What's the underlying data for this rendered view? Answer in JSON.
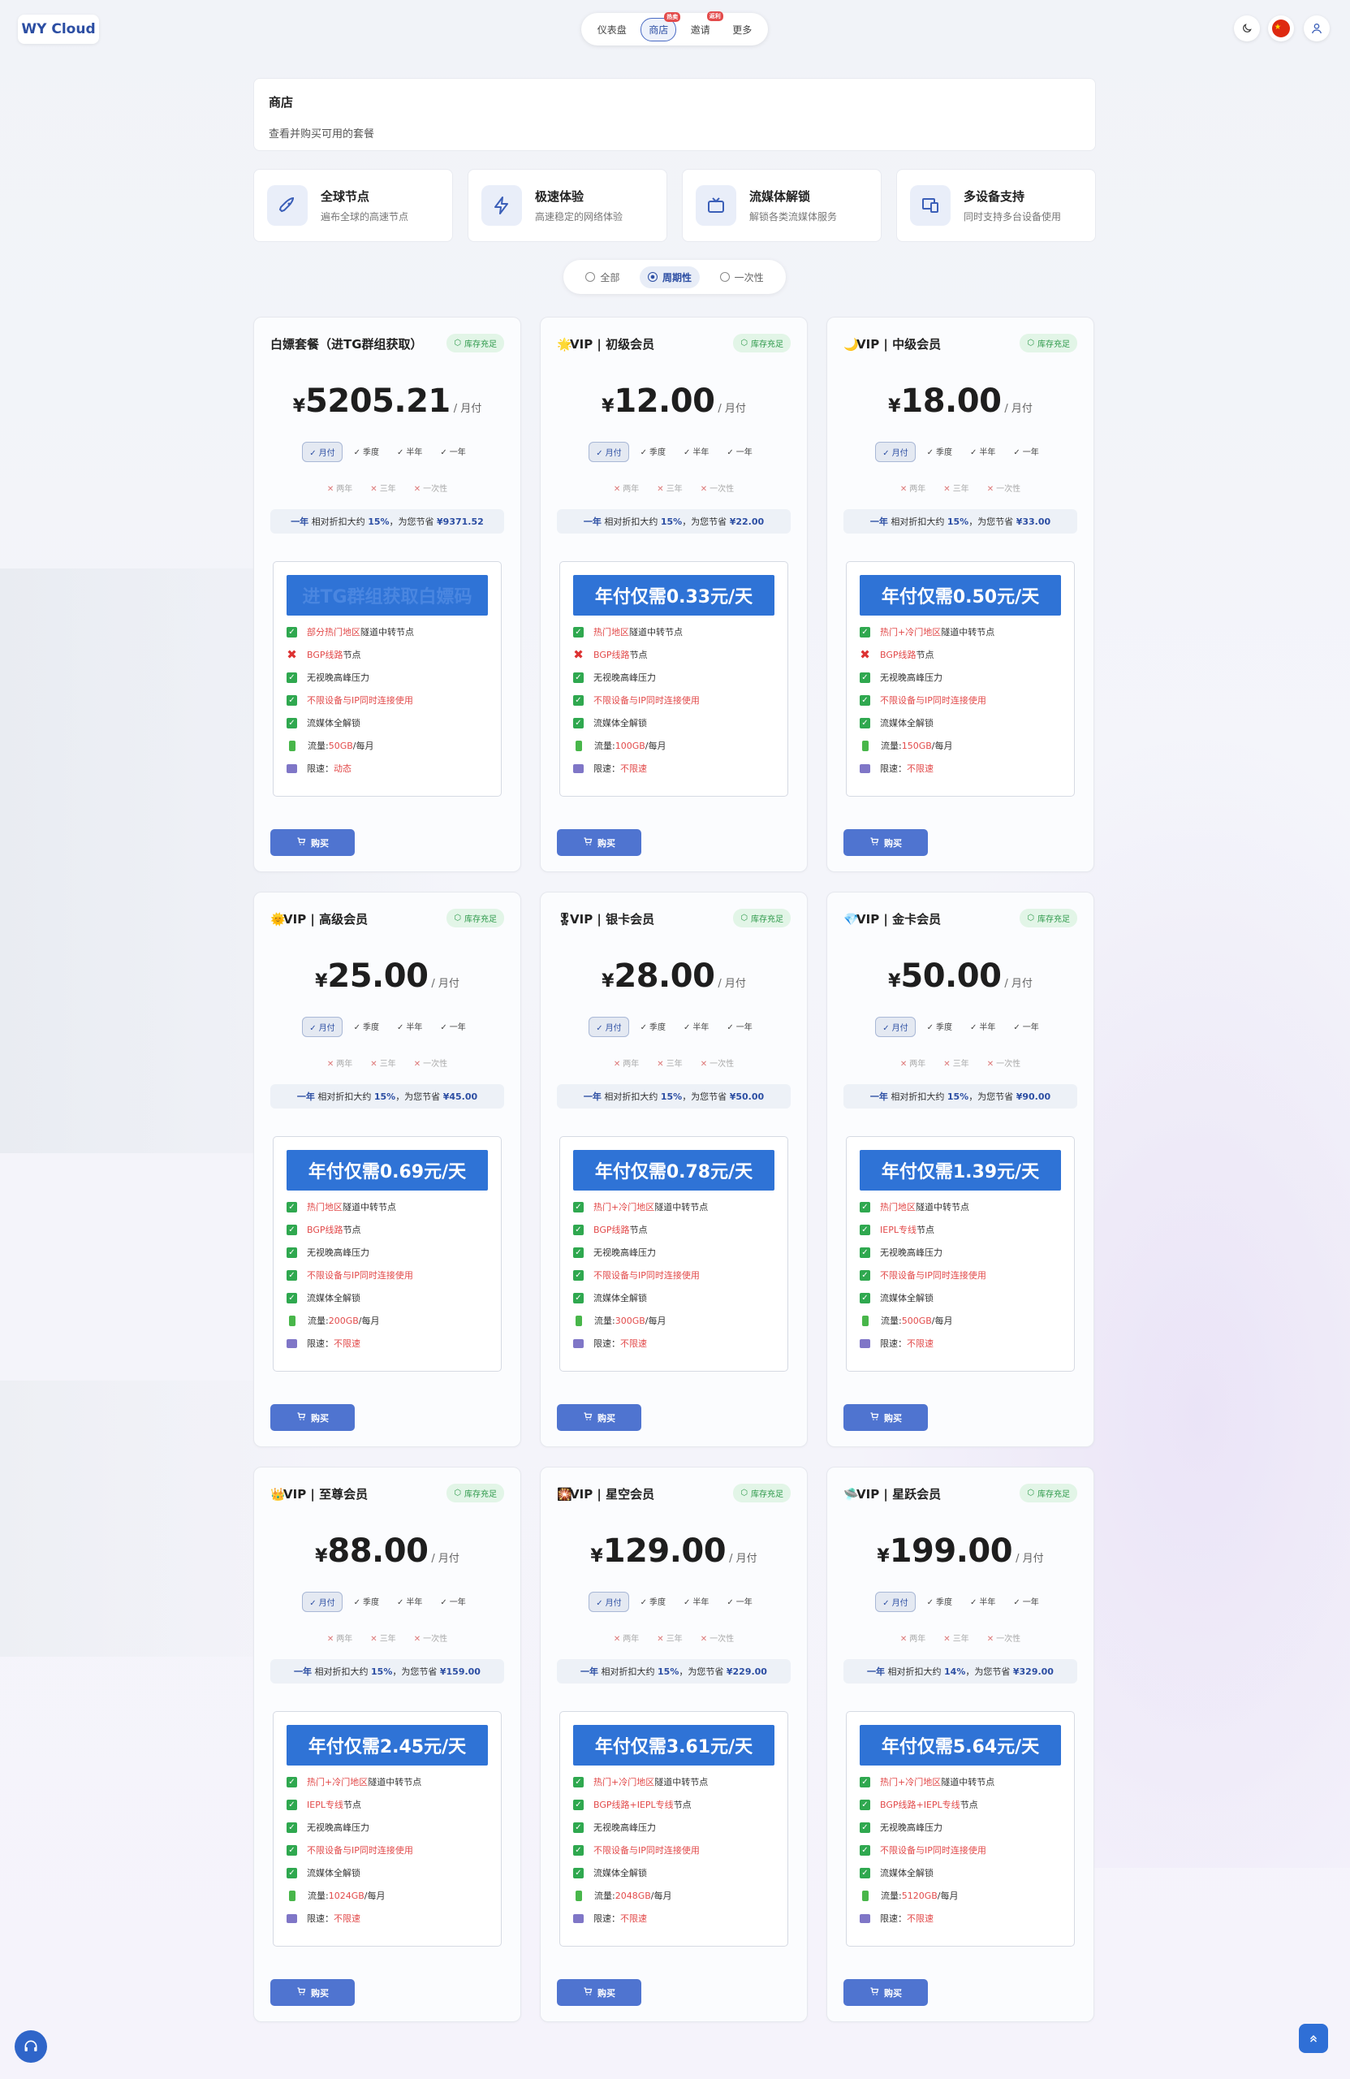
{
  "brand": "WY Cloud",
  "nav": [
    {
      "label": "仪表盘",
      "badge": ""
    },
    {
      "label": "商店",
      "badge": "热卖",
      "active": true
    },
    {
      "label": "邀请",
      "badge": "返利"
    },
    {
      "label": "更多",
      "badge": ""
    }
  ],
  "header_icons": [
    "moon-icon",
    "china-flag-icon",
    "user-icon"
  ],
  "page": {
    "title": "商店",
    "subtitle": "查看并购买可用的套餐"
  },
  "features": [
    {
      "icon": "rocket-icon",
      "title": "全球节点",
      "desc": "遍布全球的高速节点"
    },
    {
      "icon": "lightning-icon",
      "title": "极速体验",
      "desc": "高速稳定的网络体验"
    },
    {
      "icon": "tv-icon",
      "title": "流媒体解锁",
      "desc": "解锁各类流媒体服务"
    },
    {
      "icon": "devices-icon",
      "title": "多设备支持",
      "desc": "同时支持多台设备使用"
    }
  ],
  "filter": {
    "options": [
      "全部",
      "周期性",
      "一次性"
    ],
    "selected": 1
  },
  "colors": {
    "primary": "#2f73d6",
    "button": "#4f74d0",
    "stock": "#2f9a4c",
    "red": "#e24a4a"
  },
  "period_labels": {
    "month": "月付",
    "quarter": "季度",
    "half": "半年",
    "year": "一年",
    "two": "两年",
    "three": "三年",
    "once": "一次性"
  },
  "stock_label": "库存充足",
  "per_label": "/ 月付",
  "currency": "¥",
  "buy_label": "购买",
  "discount_text": {
    "prefix": "一年",
    "mid": "相对折扣大约",
    "save": "，为您节省"
  },
  "plans": [
    {
      "emoji": "",
      "name": "白嫖套餐（进TG群组获取）",
      "price": "5205.21",
      "banner": "进TG群组获取白嫖码",
      "ghost": true,
      "discount_pct": "15%",
      "discount_save": "¥9371.52",
      "features": [
        {
          "icon": "check",
          "red": "部分热门地区",
          "text": " 隧道中转节点"
        },
        {
          "icon": "cross",
          "red": "BGP线路",
          "text": "节点"
        },
        {
          "icon": "check",
          "red": "",
          "text": "无视晚高峰压力"
        },
        {
          "icon": "check",
          "red": "不限设备与IP同时连接使用",
          "text": ""
        },
        {
          "icon": "check",
          "red": "",
          "text": "流媒体全解锁"
        },
        {
          "icon": "battery",
          "pre": "流量:",
          "red": "50GB",
          "text": " /每月"
        },
        {
          "icon": "speed",
          "pre": "限速：",
          "red": "动态",
          "text": ""
        }
      ]
    },
    {
      "emoji": "🌟",
      "name": "VIP | 初级会员",
      "price": "12.00",
      "banner": "年付仅需0.33元/天",
      "discount_pct": "15%",
      "discount_save": "¥22.00",
      "features": [
        {
          "icon": "check",
          "red": "热门地区",
          "text": " 隧道中转节点"
        },
        {
          "icon": "cross",
          "red": "BGP线路",
          "text": "节点"
        },
        {
          "icon": "check",
          "red": "",
          "text": "无视晚高峰压力"
        },
        {
          "icon": "check",
          "red": "不限设备与IP同时连接使用",
          "text": ""
        },
        {
          "icon": "check",
          "red": "",
          "text": "流媒体全解锁"
        },
        {
          "icon": "battery",
          "pre": "流量:",
          "red": "100GB",
          "text": " /每月"
        },
        {
          "icon": "speed",
          "pre": "限速：",
          "red": "不限速",
          "text": ""
        }
      ]
    },
    {
      "emoji": "🌙",
      "name": "VIP | 中级会员",
      "price": "18.00",
      "banner": "年付仅需0.50元/天",
      "discount_pct": "15%",
      "discount_save": "¥33.00",
      "features": [
        {
          "icon": "check",
          "red": "热门+冷门地区",
          "text": " 隧道中转节点"
        },
        {
          "icon": "cross",
          "red": "BGP线路",
          "text": "节点"
        },
        {
          "icon": "check",
          "red": "",
          "text": "无视晚高峰压力"
        },
        {
          "icon": "check",
          "red": "不限设备与IP同时连接使用",
          "text": ""
        },
        {
          "icon": "check",
          "red": "",
          "text": "流媒体全解锁"
        },
        {
          "icon": "battery",
          "pre": "流量:",
          "red": "150GB",
          "text": " /每月"
        },
        {
          "icon": "speed",
          "pre": "限速：",
          "red": "不限速",
          "text": ""
        }
      ]
    },
    {
      "emoji": "🌞",
      "name": "VIP | 高级会员",
      "price": "25.00",
      "banner": "年付仅需0.69元/天",
      "discount_pct": "15%",
      "discount_save": "¥45.00",
      "features": [
        {
          "icon": "check",
          "red": "热门地区",
          "text": " 隧道中转节点"
        },
        {
          "icon": "check",
          "red": "BGP线路",
          "text": "节点"
        },
        {
          "icon": "check",
          "red": "",
          "text": "无视晚高峰压力"
        },
        {
          "icon": "check",
          "red": "不限设备与IP同时连接使用",
          "text": ""
        },
        {
          "icon": "check",
          "red": "",
          "text": "流媒体全解锁"
        },
        {
          "icon": "battery",
          "pre": "流量:",
          "red": "200GB",
          "text": " /每月"
        },
        {
          "icon": "speed",
          "pre": "限速：",
          "red": "不限速",
          "text": ""
        }
      ]
    },
    {
      "emoji": "🎖",
      "name": "VIP | 银卡会员",
      "price": "28.00",
      "banner": "年付仅需0.78元/天",
      "discount_pct": "15%",
      "discount_save": "¥50.00",
      "features": [
        {
          "icon": "check",
          "red": "热门+冷门地区",
          "text": " 隧道中转节点"
        },
        {
          "icon": "check",
          "red": "BGP线路",
          "text": "节点"
        },
        {
          "icon": "check",
          "red": "",
          "text": "无视晚高峰压力"
        },
        {
          "icon": "check",
          "red": "不限设备与IP同时连接使用",
          "text": ""
        },
        {
          "icon": "check",
          "red": "",
          "text": "流媒体全解锁"
        },
        {
          "icon": "battery",
          "pre": "流量:",
          "red": "300GB",
          "text": " /每月"
        },
        {
          "icon": "speed",
          "pre": "限速：",
          "red": "不限速",
          "text": ""
        }
      ]
    },
    {
      "emoji": "💎",
      "name": "VIP | 金卡会员",
      "price": "50.00",
      "banner": "年付仅需1.39元/天",
      "discount_pct": "15%",
      "discount_save": "¥90.00",
      "features": [
        {
          "icon": "check",
          "red": "热门地区",
          "text": " 隧道中转节点"
        },
        {
          "icon": "check",
          "red": "IEPL专线",
          "text": "节点"
        },
        {
          "icon": "check",
          "red": "",
          "text": "无视晚高峰压力"
        },
        {
          "icon": "check",
          "red": "不限设备与IP同时连接使用",
          "text": ""
        },
        {
          "icon": "check",
          "red": "",
          "text": "流媒体全解锁"
        },
        {
          "icon": "battery",
          "pre": "流量:",
          "red": "500GB",
          "text": " /每月"
        },
        {
          "icon": "speed",
          "pre": "限速：",
          "red": "不限速",
          "text": ""
        }
      ]
    },
    {
      "emoji": "👑",
      "name": "VIP | 至尊会员",
      "price": "88.00",
      "banner": "年付仅需2.45元/天",
      "discount_pct": "15%",
      "discount_save": "¥159.00",
      "features": [
        {
          "icon": "check",
          "red": "热门+冷门地区",
          "text": " 隧道中转节点"
        },
        {
          "icon": "check",
          "red": "IEPL专线",
          "text": "节点"
        },
        {
          "icon": "check",
          "red": "",
          "text": "无视晚高峰压力"
        },
        {
          "icon": "check",
          "red": "不限设备与IP同时连接使用",
          "text": ""
        },
        {
          "icon": "check",
          "red": "",
          "text": "流媒体全解锁"
        },
        {
          "icon": "battery",
          "pre": "流量:",
          "red": "1024GB",
          "text": " /每月"
        },
        {
          "icon": "speed",
          "pre": "限速：",
          "red": "不限速",
          "text": ""
        }
      ]
    },
    {
      "emoji": "🎇",
      "name": "VIP | 星空会员",
      "price": "129.00",
      "banner": "年付仅需3.61元/天",
      "discount_pct": "15%",
      "discount_save": "¥229.00",
      "features": [
        {
          "icon": "check",
          "red": "热门+冷门地区",
          "text": " 隧道中转节点"
        },
        {
          "icon": "check",
          "red": "BGP线路+IEPL专线",
          "text": "节点"
        },
        {
          "icon": "check",
          "red": "",
          "text": "无视晚高峰压力"
        },
        {
          "icon": "check",
          "red": "不限设备与IP同时连接使用",
          "text": ""
        },
        {
          "icon": "check",
          "red": "",
          "text": "流媒体全解锁"
        },
        {
          "icon": "battery",
          "pre": "流量:",
          "red": "2048GB",
          "text": " /每月"
        },
        {
          "icon": "speed",
          "pre": "限速：",
          "red": "不限速",
          "text": ""
        }
      ]
    },
    {
      "emoji": "🛸",
      "name": "VIP | 星跃会员",
      "price": "199.00",
      "banner": "年付仅需5.64元/天",
      "discount_pct": "14%",
      "discount_save": "¥329.00",
      "features": [
        {
          "icon": "check",
          "red": "热门+冷门地区",
          "text": " 隧道中转节点"
        },
        {
          "icon": "check",
          "red": "BGP线路+IEPL专线",
          "text": "节点"
        },
        {
          "icon": "check",
          "red": "",
          "text": "无视晚高峰压力"
        },
        {
          "icon": "check",
          "red": "不限设备与IP同时连接使用",
          "text": ""
        },
        {
          "icon": "check",
          "red": "",
          "text": "流媒体全解锁"
        },
        {
          "icon": "battery",
          "pre": "流量:",
          "red": "5120GB",
          "text": " /每月"
        },
        {
          "icon": "speed",
          "pre": "限速：",
          "red": "不限速",
          "text": ""
        }
      ]
    }
  ]
}
